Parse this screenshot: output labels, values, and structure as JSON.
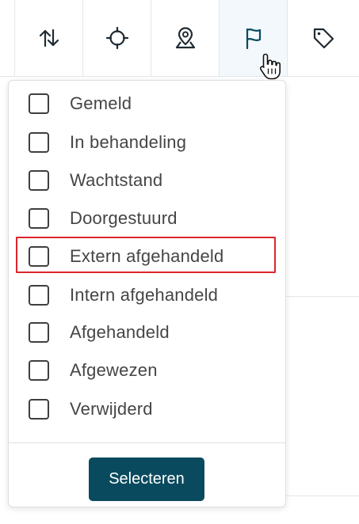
{
  "toolbar": {
    "buttons": [
      {
        "icon": "sort-arrows-icon",
        "active": false
      },
      {
        "icon": "crosshair-icon",
        "active": false
      },
      {
        "icon": "map-pin-person-icon",
        "active": false
      },
      {
        "icon": "flag-icon",
        "active": true
      },
      {
        "icon": "tag-icon",
        "active": false
      }
    ]
  },
  "status_filter": {
    "options": [
      {
        "label": "Gemeld",
        "checked": false
      },
      {
        "label": "In behandeling",
        "checked": false
      },
      {
        "label": "Wachtstand",
        "checked": false
      },
      {
        "label": "Doorgestuurd",
        "checked": false
      },
      {
        "label": "Extern afgehandeld",
        "checked": false,
        "highlighted": true
      },
      {
        "label": "Intern afgehandeld",
        "checked": false
      },
      {
        "label": "Afgehandeld",
        "checked": false
      },
      {
        "label": "Afgewezen",
        "checked": false
      },
      {
        "label": "Verwijderd",
        "checked": false
      }
    ],
    "select_button_label": "Selecteren"
  },
  "colors": {
    "button_primary": "#0a4a5f",
    "active_tab_bg": "#f2f8fb",
    "icon_stroke": "#1f2a33",
    "flag_icon_stroke": "#0a4a5f",
    "highlight_border": "#d9262b",
    "label_text": "#454545"
  }
}
